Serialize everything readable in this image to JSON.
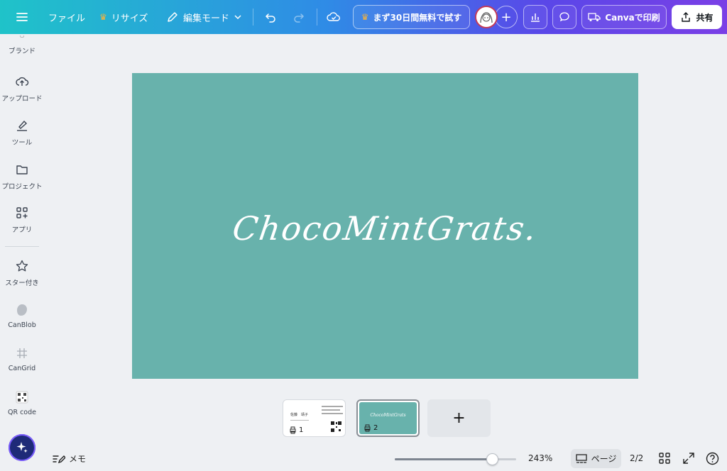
{
  "topbar": {
    "file_label": "ファイル",
    "resize_label": "リサイズ",
    "edit_mode_label": "編集モード",
    "trial_label": "まず30日間無料で試す",
    "print_label": "Canvaで印刷",
    "share_label": "共有"
  },
  "sidebar": {
    "items": [
      {
        "label": "ブランド"
      },
      {
        "label": "アップロード"
      },
      {
        "label": "ツール"
      },
      {
        "label": "プロジェクト"
      },
      {
        "label": "アプリ"
      },
      {
        "label": "スター付き"
      },
      {
        "label": "CanBlob"
      },
      {
        "label": "CanGrid"
      },
      {
        "label": "QR code"
      }
    ]
  },
  "canvas": {
    "background": "#68b2ac",
    "title": "ChocoMintGrats."
  },
  "pages": [
    {
      "number": "1",
      "name_text": "佐藤　靖子"
    },
    {
      "number": "2",
      "title": "ChocoMintGrats"
    }
  ],
  "bottombar": {
    "memo_label": "メモ",
    "zoom": "243%",
    "zoom_fraction": 0.8,
    "page_view_label": "ページ",
    "page_count": "2/2"
  },
  "colors": {
    "accent_gradient_start": "#1fc3c9",
    "accent_gradient_end": "#7a3fe6",
    "canvas_teal": "#68b2ac"
  }
}
